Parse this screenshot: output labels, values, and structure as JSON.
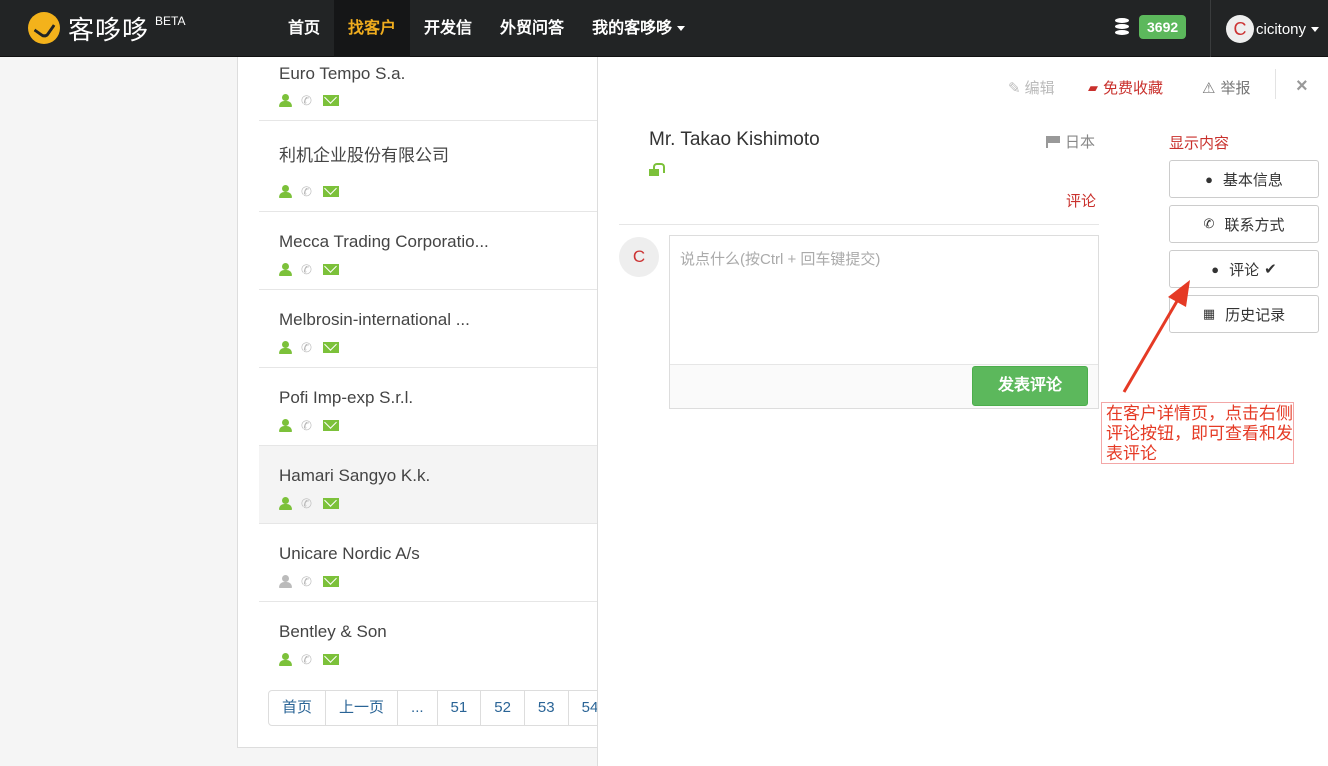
{
  "brand": {
    "name": "客哆哆",
    "beta": "BETA"
  },
  "nav": {
    "items": [
      "首页",
      "找客户",
      "开发信",
      "外贸问答",
      "我的客哆哆"
    ],
    "active_index": 1
  },
  "user": {
    "coins": "3692",
    "avatar_letter": "C",
    "username": "cicitony"
  },
  "list": {
    "companies": [
      {
        "name": "Euro Tempo S.a.",
        "person_active": true
      },
      {
        "name": "利机企业股份有限公司",
        "person_active": true
      },
      {
        "name": "Mecca Trading Corporatio...",
        "person_active": true
      },
      {
        "name": "Melbrosin-international ...",
        "person_active": true
      },
      {
        "name": "Pofi Imp-exp S.r.l.",
        "person_active": true
      },
      {
        "name": "Hamari Sangyo K.k.",
        "person_active": true
      },
      {
        "name": "Unicare Nordic A/s",
        "person_active": false
      },
      {
        "name": "Bentley & Son",
        "person_active": true
      }
    ],
    "pager": [
      "首页",
      "上一页",
      "...",
      "51",
      "52",
      "53",
      "54"
    ]
  },
  "detail": {
    "toolbar": {
      "edit": "编辑",
      "favorite": "免费收藏",
      "report": "举报",
      "close": "×"
    },
    "contact_name": "Mr. Takao Kishimoto",
    "country": "日本",
    "section_label": "评论",
    "comment": {
      "avatar_letter": "C",
      "placeholder": "说点什么(按Ctrl + 回车键提交)",
      "submit_label": "发表评论"
    },
    "side": {
      "title": "显示内容",
      "buttons": [
        {
          "label": "基本信息",
          "icon": "user-icon"
        },
        {
          "label": "联系方式",
          "icon": "phone-icon"
        },
        {
          "label": "评论",
          "icon": "comment-icon",
          "checked": true
        },
        {
          "label": "历史记录",
          "icon": "calendar-icon"
        }
      ]
    }
  },
  "annotation": {
    "text": "在客户详情页，点击右侧评论按钮，即可查看和发表评论"
  },
  "colors": {
    "navbar": "#222425",
    "accent_green": "#5cb85c",
    "icon_green": "#7cc13a",
    "link_red": "#c9302c",
    "active_nav": "#f0ad1e"
  }
}
